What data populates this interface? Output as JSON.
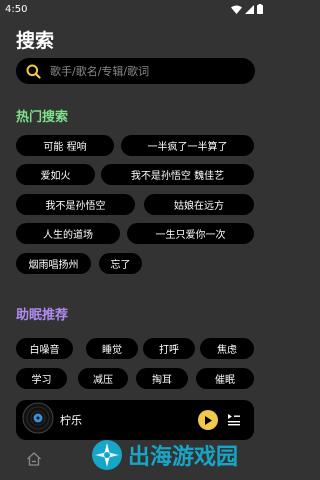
{
  "status_bar": {
    "time": "4:50"
  },
  "page": {
    "title": "搜索"
  },
  "search": {
    "placeholder": "歌手/歌名/专辑/歌词"
  },
  "colors": {
    "hot_title": "#7ee08a",
    "sleep_title": "#b08cf0",
    "accent": "#f2c94c"
  },
  "hot_search": {
    "title": "热门搜索",
    "tags": [
      "可能 程响",
      "一半疯了一半算了",
      "爱如火",
      "我不是孙悟空 魏佳艺",
      "我不是孙悟空",
      "姑娘在远方",
      "人生的道场",
      "一生只爱你一次",
      "烟雨唱扬州",
      "忘了"
    ]
  },
  "sleep_recommend": {
    "title": "助眠推荐",
    "tags": [
      "白噪音",
      "睡觉",
      "打呼",
      "焦虑",
      "学习",
      "减压",
      "掏耳",
      "催眠"
    ]
  },
  "player": {
    "title": "柠乐"
  },
  "watermark": {
    "text": "出海游戏园"
  }
}
